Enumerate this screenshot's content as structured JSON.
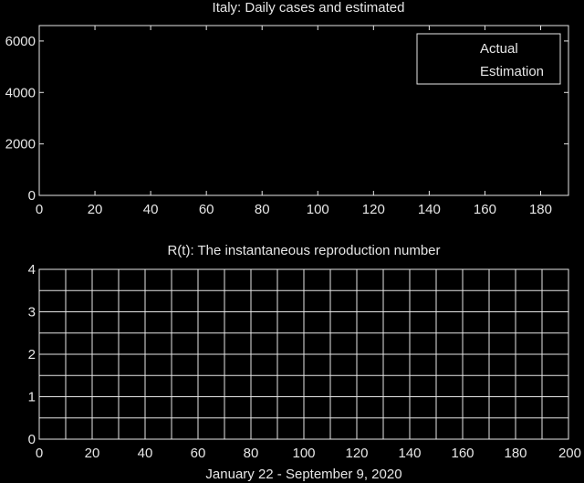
{
  "colors": {
    "background": "#000000",
    "axis": "#e6e6e6",
    "grid": "#e6e6e6",
    "text": "#e6e6e6"
  },
  "chart_data": [
    {
      "type": "line",
      "title": "Italy: Daily cases and estimated",
      "xlabel": "",
      "ylabel": "",
      "xlim": [
        0,
        190
      ],
      "ylim": [
        0,
        6600
      ],
      "x_ticks": [
        0,
        20,
        40,
        60,
        80,
        100,
        120,
        140,
        160,
        180
      ],
      "y_ticks": [
        0,
        2000,
        4000,
        6000
      ],
      "grid": false,
      "legend": {
        "placement": "top-right",
        "entries": [
          "Actual",
          "Estimation"
        ]
      },
      "series": []
    },
    {
      "type": "line",
      "title": "R(t): The instantaneous reproduction number",
      "xlabel": "January 22 - September 9, 2020",
      "ylabel": "",
      "xlim": [
        0,
        200
      ],
      "ylim": [
        0,
        4
      ],
      "x_ticks": [
        0,
        20,
        40,
        60,
        80,
        100,
        120,
        140,
        160,
        180,
        200
      ],
      "y_ticks": [
        0,
        1,
        2,
        3,
        4
      ],
      "grid": true,
      "legend": null,
      "series": []
    }
  ]
}
